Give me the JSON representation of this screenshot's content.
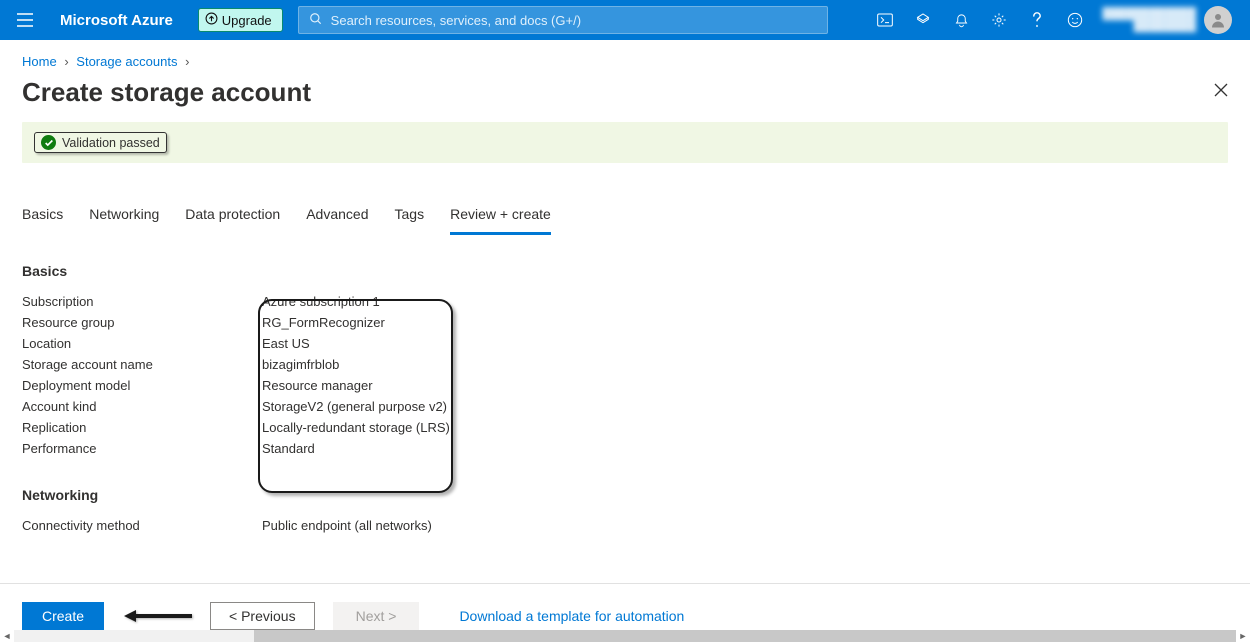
{
  "header": {
    "brand": "Microsoft Azure",
    "upgrade_label": "Upgrade",
    "search_placeholder": "Search resources, services, and docs (G+/)"
  },
  "breadcrumbs": {
    "items": [
      "Home",
      "Storage accounts"
    ]
  },
  "page": {
    "title": "Create storage account"
  },
  "validation": {
    "message": "Validation passed"
  },
  "tabs": [
    {
      "label": "Basics"
    },
    {
      "label": "Networking"
    },
    {
      "label": "Data protection"
    },
    {
      "label": "Advanced"
    },
    {
      "label": "Tags"
    },
    {
      "label": "Review + create",
      "active": true
    }
  ],
  "sections": {
    "basics": {
      "title": "Basics",
      "rows": [
        {
          "label": "Subscription",
          "value": "Azure subscription 1"
        },
        {
          "label": "Resource group",
          "value": "RG_FormRecognizer"
        },
        {
          "label": "Location",
          "value": "East US"
        },
        {
          "label": "Storage account name",
          "value": "bizagimfrblob"
        },
        {
          "label": "Deployment model",
          "value": "Resource manager"
        },
        {
          "label": "Account kind",
          "value": "StorageV2 (general purpose v2)"
        },
        {
          "label": "Replication",
          "value": "Locally-redundant storage (LRS)"
        },
        {
          "label": "Performance",
          "value": "Standard"
        }
      ]
    },
    "networking": {
      "title": "Networking",
      "rows": [
        {
          "label": "Connectivity method",
          "value": "Public endpoint (all networks)"
        }
      ]
    }
  },
  "footer": {
    "create_label": "Create",
    "previous_label": "< Previous",
    "next_label": "Next >",
    "template_link": "Download a template for automation"
  },
  "colors": {
    "azure_blue": "#0078d4",
    "success_green": "#107c10",
    "banner_bg": "#f0f7e4"
  }
}
